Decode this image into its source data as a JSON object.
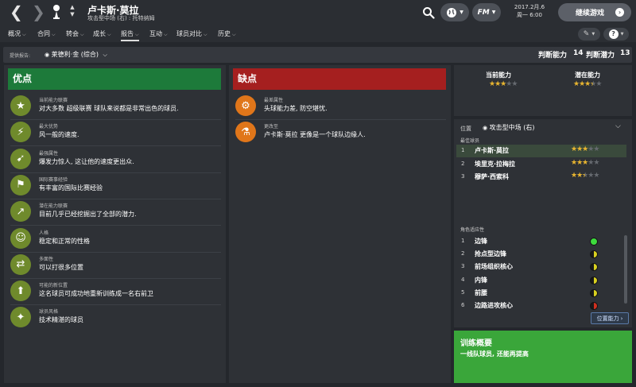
{
  "header": {
    "player_name": "卢卡斯·莫拉",
    "player_subtitle": "攻击型中场 (右) : 托特纳姆",
    "date_line1": "2017.2月.6",
    "date_line2": "周一 6:00",
    "continue_label": "继续游戏",
    "fm_label": "FM"
  },
  "menu": {
    "items": [
      "概况",
      "合同",
      "转会",
      "成长",
      "报告",
      "互动",
      "球员对比",
      "历史"
    ],
    "active_index": 4
  },
  "report": {
    "provided_label": "提供报告:",
    "scout_name": "莱德利·金 (综合)",
    "judge_ability_label": "判断能力",
    "judge_ability_value": "14",
    "judge_potential_label": "判断潜力",
    "judge_potential_value": "13"
  },
  "strengths": {
    "title": "优点",
    "items": [
      {
        "icon": "star-icon",
        "label": "当前能力联赛",
        "text": "对大多数 超级联赛 球队来说都是非常出色的球员."
      },
      {
        "icon": "lightning-icon",
        "label": "最大优势",
        "text": "风一般的速度."
      },
      {
        "icon": "sprint-icon",
        "label": "最强属性",
        "text": "爆发力惊人, 这让他的速度更出众."
      },
      {
        "icon": "flag-icon",
        "label": "国际赛事经验",
        "text": "有丰富的国际比赛经验"
      },
      {
        "icon": "trend-up-icon",
        "label": "潜在能力联赛",
        "text": "目前几乎已经挖掘出了全部的潜力."
      },
      {
        "icon": "head-icon",
        "label": "人格",
        "text": "稳定和正常的性格"
      },
      {
        "icon": "arrows-icon",
        "label": "多面性",
        "text": "可以打很多位置"
      },
      {
        "icon": "position-icon",
        "label": "可能的新位置",
        "text": "这名球员可成功地重新训练成一名右前卫"
      },
      {
        "icon": "style-icon",
        "label": "球员风格",
        "text": "技术精湛的球员"
      }
    ]
  },
  "weaknesses": {
    "title": "缺点",
    "items": [
      {
        "icon": "cog-icon",
        "label": "最差属性",
        "text": "头球能力差, 防空堪忧."
      },
      {
        "icon": "flask-icon",
        "label": "更改至",
        "text": "卢卡斯·莫拉 更像是一个球队边缘人."
      }
    ]
  },
  "ability": {
    "current_label": "当前能力",
    "current_stars": 3,
    "potential_label": "潜在能力",
    "potential_stars": 3.5
  },
  "position": {
    "label": "位置",
    "value": "攻击型中场 (右)",
    "best_players_label": "最佳球员",
    "players": [
      {
        "rank": "1",
        "name": "卢卡斯·莫拉",
        "stars": 3
      },
      {
        "rank": "2",
        "name": "埃里克·拉梅拉",
        "stars": 3
      },
      {
        "rank": "3",
        "name": "穆萨·西索科",
        "stars": 2.5
      }
    ],
    "roles_label": "角色适应性",
    "roles": [
      {
        "rank": "1",
        "name": "边锋",
        "color": "#3ddb3d",
        "level": 1.0
      },
      {
        "rank": "2",
        "name": "抢点型边锋",
        "color": "#d8d020",
        "level": 0.5
      },
      {
        "rank": "3",
        "name": "前场组织核心",
        "color": "#d8d020",
        "level": 0.5
      },
      {
        "rank": "4",
        "name": "内锋",
        "color": "#d8d020",
        "level": 0.5
      },
      {
        "rank": "5",
        "name": "前腰",
        "color": "#d8d020",
        "level": 0.5
      },
      {
        "rank": "6",
        "name": "边路进攻核心",
        "color": "#d03020",
        "level": 0.5
      }
    ],
    "position_ability_button": "位置能力"
  },
  "training": {
    "title": "训练概要",
    "text": "一线队球员, 还能再提高"
  },
  "colors": {
    "strength_green": "#1d7a3a",
    "weakness_red": "#a51f1f",
    "training_green": "#3aa63a",
    "star_gold": "#e8b530"
  }
}
